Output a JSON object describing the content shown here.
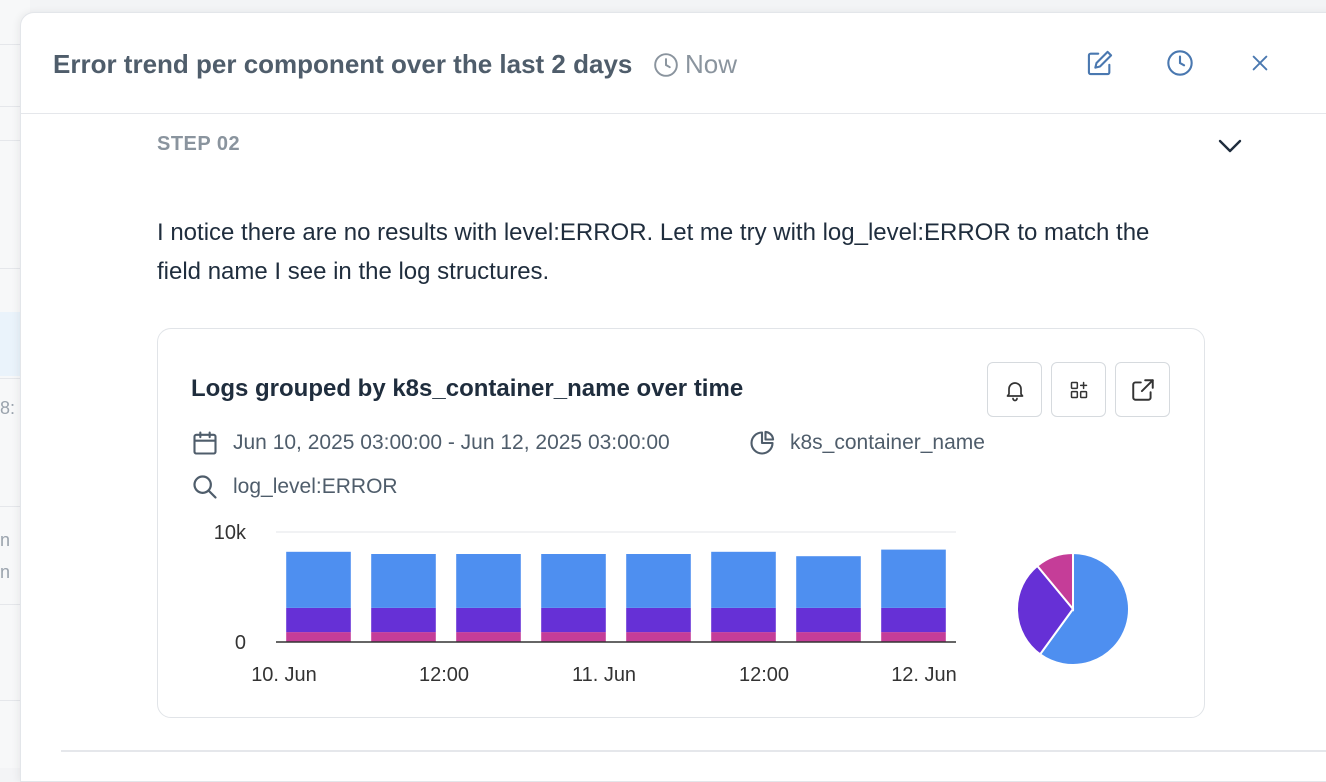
{
  "header": {
    "title": "Error trend per component over the last 2 days",
    "time_label": "Now"
  },
  "step": {
    "label": "STEP 02",
    "message": "I notice there are no results with level:ERROR. Let me try with log_level:ERROR to match the field name I see in the log structures."
  },
  "card": {
    "title": "Logs grouped by k8s_container_name over time",
    "date_range": "Jun 10, 2025 03:00:00 - Jun 12, 2025 03:00:00",
    "group_by": "k8s_container_name",
    "query": "log_level:ERROR"
  },
  "colors": {
    "blue": "#4e8ff0",
    "purple": "#6630d6",
    "magenta": "#c53d98"
  },
  "chart_data": {
    "type": "bar",
    "stacked": true,
    "ylim": [
      0,
      10000
    ],
    "y_ticks": [
      "0",
      "10k"
    ],
    "x_tick_labels": [
      "10. Jun",
      "12:00",
      "11. Jun",
      "12:00",
      "12. Jun"
    ],
    "categories": [
      "b1",
      "b2",
      "b3",
      "b4",
      "b5",
      "b6",
      "b7",
      "b8"
    ],
    "series": [
      {
        "color": "#c53d98",
        "values": [
          900,
          900,
          900,
          900,
          900,
          900,
          900,
          900
        ]
      },
      {
        "color": "#6630d6",
        "values": [
          2200,
          2200,
          2200,
          2200,
          2200,
          2200,
          2200,
          2200
        ]
      },
      {
        "color": "#4e8ff0",
        "values": [
          5100,
          4900,
          4900,
          4900,
          4900,
          5100,
          4700,
          5300
        ]
      }
    ],
    "pie": {
      "type": "pie",
      "slices": [
        {
          "color": "#4e8ff0",
          "value": 60
        },
        {
          "color": "#6630d6",
          "value": 29
        },
        {
          "color": "#c53d98",
          "value": 11
        }
      ]
    }
  }
}
